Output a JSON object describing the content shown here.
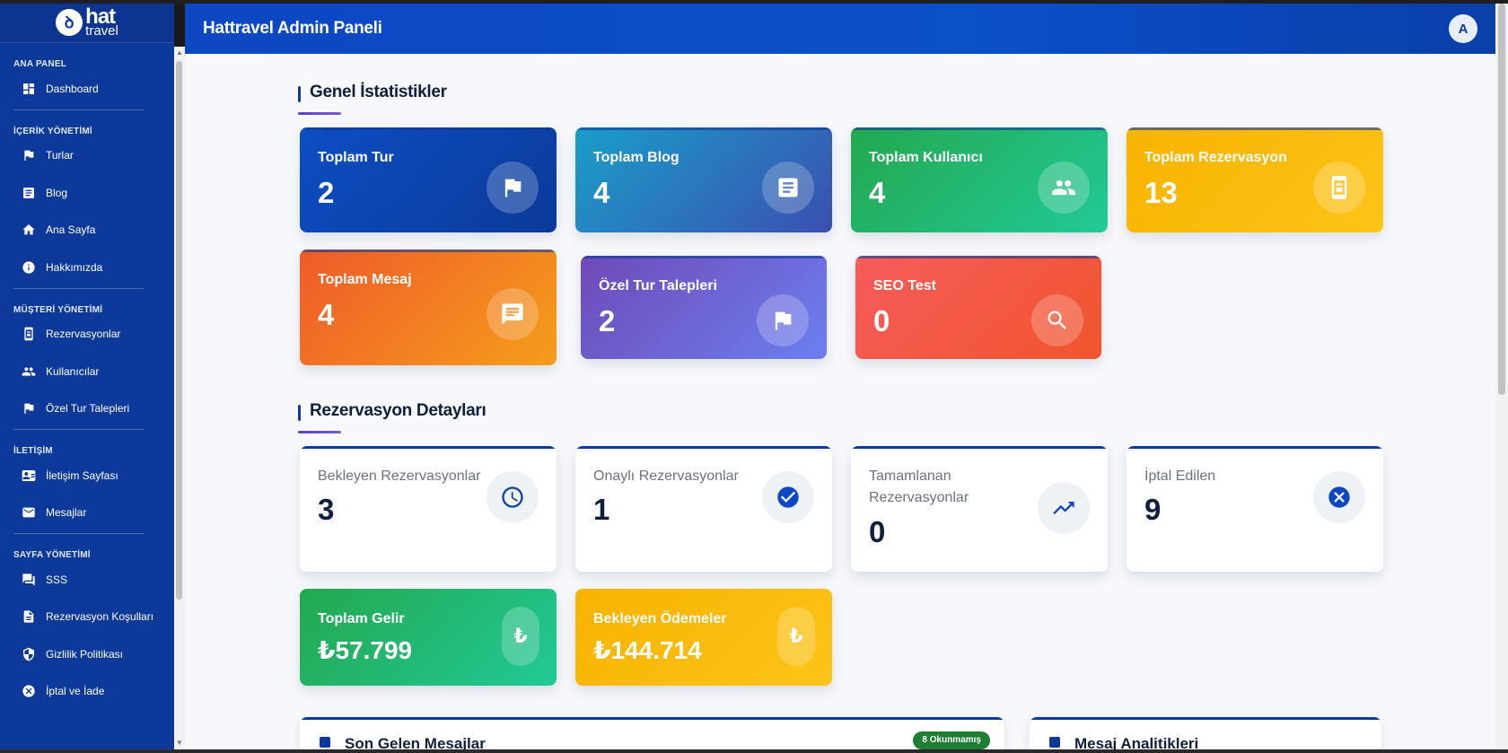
{
  "app": {
    "logo_main": "hat",
    "logo_sub": "travel",
    "header_title": "Hattravel Admin Paneli",
    "avatar_letter": "A"
  },
  "sidebar": {
    "sections": [
      {
        "title": "ANA PANEL",
        "items": [
          {
            "label": "Dashboard",
            "icon": "dashboard-icon"
          }
        ]
      },
      {
        "title": "İÇERİK YÖNETİMİ",
        "items": [
          {
            "label": "Turlar",
            "icon": "flag-icon"
          },
          {
            "label": "Blog",
            "icon": "article-icon"
          },
          {
            "label": "Ana Sayfa",
            "icon": "home-icon"
          },
          {
            "label": "Hakkımızda",
            "icon": "info-icon"
          }
        ]
      },
      {
        "title": "MÜŞTERİ YÖNETİMİ",
        "items": [
          {
            "label": "Rezervasyonlar",
            "icon": "booking-icon"
          },
          {
            "label": "Kullanıcılar",
            "icon": "people-icon"
          },
          {
            "label": "Özel Tur Talepleri",
            "icon": "flag-icon"
          }
        ]
      },
      {
        "title": "İLETİŞİM",
        "items": [
          {
            "label": "İletişim Sayfası",
            "icon": "contact-card-icon"
          },
          {
            "label": "Mesajlar",
            "icon": "mail-icon"
          }
        ]
      },
      {
        "title": "SAYFA YÖNETİMİ",
        "items": [
          {
            "label": "SSS",
            "icon": "forum-icon"
          },
          {
            "label": "Rezervasyon Koşulları",
            "icon": "document-icon"
          },
          {
            "label": "Gizlilik Politikası",
            "icon": "shield-icon"
          },
          {
            "label": "İptal ve İade",
            "icon": "cancel-circle-icon"
          }
        ]
      }
    ]
  },
  "general_stats": {
    "title": "Genel İstatistikler",
    "cards": [
      {
        "label": "Toplam Tur",
        "value": "2",
        "icon": "flag-icon",
        "gradient": [
          "#0d4ec4",
          "#0b3a99"
        ]
      },
      {
        "label": "Toplam Blog",
        "value": "4",
        "icon": "article-icon",
        "gradient": [
          "#1a9ec9",
          "#3b4fb0"
        ]
      },
      {
        "label": "Toplam Kullanıcı",
        "value": "4",
        "icon": "people-icon",
        "gradient": [
          "#23a84f",
          "#22c997"
        ]
      },
      {
        "label": "Toplam Rezervasyon",
        "value": "13",
        "icon": "booking-icon",
        "gradient": [
          "#f8b300",
          "#fcc419"
        ]
      },
      {
        "label": "Toplam Mesaj",
        "value": "4",
        "icon": "chat-icon",
        "gradient": [
          "#ef5a2a",
          "#f59e1b"
        ]
      },
      {
        "label": "Özel Tur Talepleri",
        "value": "2",
        "icon": "flag-icon",
        "gradient": [
          "#6f4ab7",
          "#6c7ff0"
        ]
      },
      {
        "label": "SEO Test",
        "value": "0",
        "icon": "search-icon",
        "gradient": [
          "#f75b5b",
          "#f0552d"
        ]
      }
    ]
  },
  "reservation_details": {
    "title": "Rezervasyon Detayları",
    "cards": [
      {
        "label": "Bekleyen Rezervasyonlar",
        "value": "3",
        "icon": "clock-icon"
      },
      {
        "label": "Onaylı Rezervasyonlar",
        "value": "1",
        "icon": "check-circle-icon"
      },
      {
        "label": "Tamamlanan Rezervasyonlar",
        "value": "0",
        "icon": "trending-up-icon"
      },
      {
        "label": "İptal Edilen",
        "value": "9",
        "icon": "cancel-circle-icon"
      }
    ],
    "money": [
      {
        "label": "Toplam Gelir",
        "value": "₺57.799",
        "icon": "lira-icon",
        "gradient": [
          "#23a84f",
          "#22c997"
        ]
      },
      {
        "label": "Bekleyen Ödemeler",
        "value": "₺144.714",
        "icon": "lira-icon",
        "gradient": [
          "#f8b300",
          "#fcc419"
        ]
      }
    ]
  },
  "bottom": {
    "messages_title": "Son Gelen Mesajlar",
    "messages_badge": "8 Okunmamış",
    "analytics_title": "Mesaj Analitikleri"
  }
}
